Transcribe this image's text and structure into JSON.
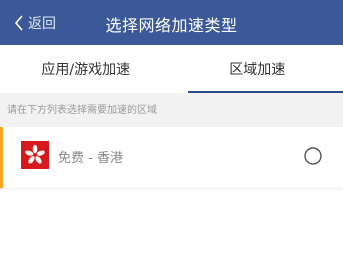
{
  "header": {
    "back_label": "返回",
    "title": "选择网络加速类型",
    "background_color": "#3b5998"
  },
  "tabs": [
    {
      "label": "应用/游戏加速",
      "active": false
    },
    {
      "label": "区域加速",
      "active": true
    }
  ],
  "hint": "请在下方列表选择需要加速的区域",
  "regions": [
    {
      "label": "免费 - 香港",
      "icon": "hong-kong-flag-icon",
      "selected": false
    }
  ],
  "colors": {
    "accent": "#f5a623",
    "tab_underline": "#2a4a8b",
    "flag_red": "#d7191c"
  }
}
